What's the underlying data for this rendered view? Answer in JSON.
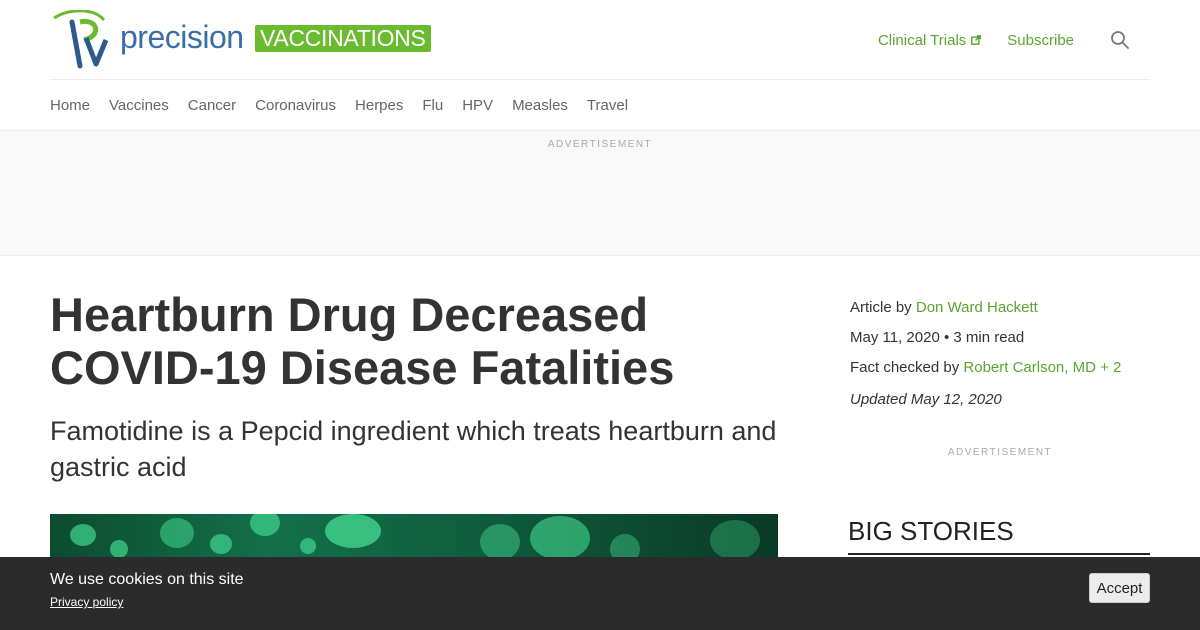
{
  "site": {
    "logo_word": "precision",
    "logo_badge": "VACCINATIONS",
    "brand_green": "#6abb2f",
    "brand_blue": "#3a6ea8"
  },
  "header": {
    "clinical_trials": "Clinical Trials",
    "subscribe": "Subscribe",
    "link_color": "#5aa530"
  },
  "nav": {
    "items": [
      "Home",
      "Vaccines",
      "Cancer",
      "Coronavirus",
      "Herpes",
      "Flu",
      "HPV",
      "Measles",
      "Travel"
    ]
  },
  "ads": {
    "top_label": "ADVERTISEMENT",
    "side_label": "ADVERTISEMENT"
  },
  "article": {
    "title": "Heartburn Drug Decreased COVID-19 Disease Fatalities",
    "subtitle": "Famotidine is a Pepcid ingredient which treats heartburn and gastric acid"
  },
  "meta": {
    "by_prefix": "Article by",
    "author": "Don Ward Hackett",
    "date_read": "May 11, 2020 • 3 min read",
    "fact_prefix": "Fact checked by",
    "fact_checker": "Robert Carlson, MD",
    "fact_more": "+ 2",
    "updated": "Updated May 12, 2020"
  },
  "sidebar": {
    "big_stories": "BIG STORIES"
  },
  "cookie": {
    "message": "We use cookies on this site",
    "policy": "Privacy policy",
    "accept": "Accept"
  },
  "icons": {
    "external": "external-link-icon",
    "search": "search-icon"
  }
}
